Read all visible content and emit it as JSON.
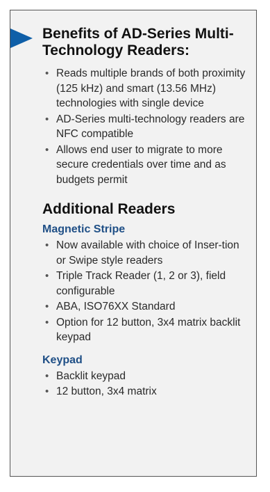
{
  "benefits": {
    "heading": "Benefits of AD-Series Multi-Technology Readers:",
    "bullet_glyph": "•",
    "items": [
      "Reads multiple brands of both proximity (125 kHz) and smart (13.56 MHz) technologies with single device",
      "AD-Series multi-technology readers are NFC compatible",
      "Allows end user to migrate to more secure credentials over time and as budgets permit"
    ]
  },
  "additional": {
    "heading": "Additional Readers",
    "magnetic": {
      "title": "Magnetic Stripe",
      "items": [
        "Now available with choice of Inser-tion or Swipe style readers",
        "Triple Track Reader (1, 2 or 3), field configurable",
        "ABA, ISO76XX Standard",
        "Option for 12 button, 3x4 matrix backlit keypad"
      ]
    },
    "keypad": {
      "title": "Keypad",
      "items": [
        "Backlit keypad",
        "12 button, 3x4 matrix"
      ]
    }
  },
  "colors": {
    "arrow": "#0f5fa8",
    "category": "#1f4f86",
    "panel_bg": "#f2f2f2",
    "panel_border": "#555555"
  },
  "icons": {
    "pointer": "arrow-right-icon"
  }
}
